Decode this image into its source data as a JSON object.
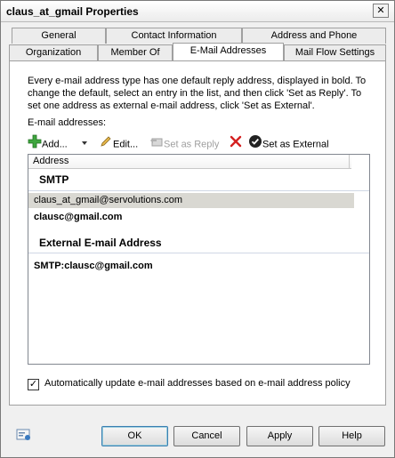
{
  "window": {
    "title": "claus_at_gmail Properties",
    "close_label": "✕"
  },
  "tabs_row1": [
    {
      "label": "General"
    },
    {
      "label": "Contact Information"
    },
    {
      "label": "Address and Phone"
    }
  ],
  "tabs_row2": [
    {
      "label": "Organization"
    },
    {
      "label": "Member Of"
    },
    {
      "label": "E-Mail Addresses",
      "active": true
    },
    {
      "label": "Mail Flow Settings"
    }
  ],
  "panel": {
    "description": "Every e-mail address type has one default reply address, displayed in bold. To change the default, select an entry in the list, and then click 'Set as Reply'. To set one address as external e-mail address, click 'Set as External'.",
    "addresses_label": "E-mail addresses:",
    "toolbar": {
      "add": "Add...",
      "edit": "Edit...",
      "set_reply": "Set as Reply",
      "set_external": "Set as External"
    },
    "list": {
      "column_header": "Address",
      "groups": [
        {
          "name": "SMTP",
          "items": [
            {
              "address": "claus_at_gmail@servolutions.com",
              "bold": false,
              "selected": true
            },
            {
              "address": "clausc@gmail.com",
              "bold": true,
              "selected": false
            }
          ]
        },
        {
          "name": "External E-mail Address",
          "items": [
            {
              "address": "SMTP:clausc@gmail.com",
              "bold": true,
              "selected": false
            }
          ]
        }
      ]
    },
    "auto_update": {
      "checked": true,
      "check_mark": "✓",
      "label": "Automatically update e-mail addresses based on e-mail address policy"
    }
  },
  "buttons": {
    "ok": "OK",
    "cancel": "Cancel",
    "apply": "Apply",
    "help": "Help"
  },
  "colors": {
    "add_icon": "#3fa63f",
    "delete_icon": "#d42020",
    "selection": "#d9d8d2",
    "panel_bg": "#ffffff",
    "window_bg": "#f0f0f0"
  }
}
